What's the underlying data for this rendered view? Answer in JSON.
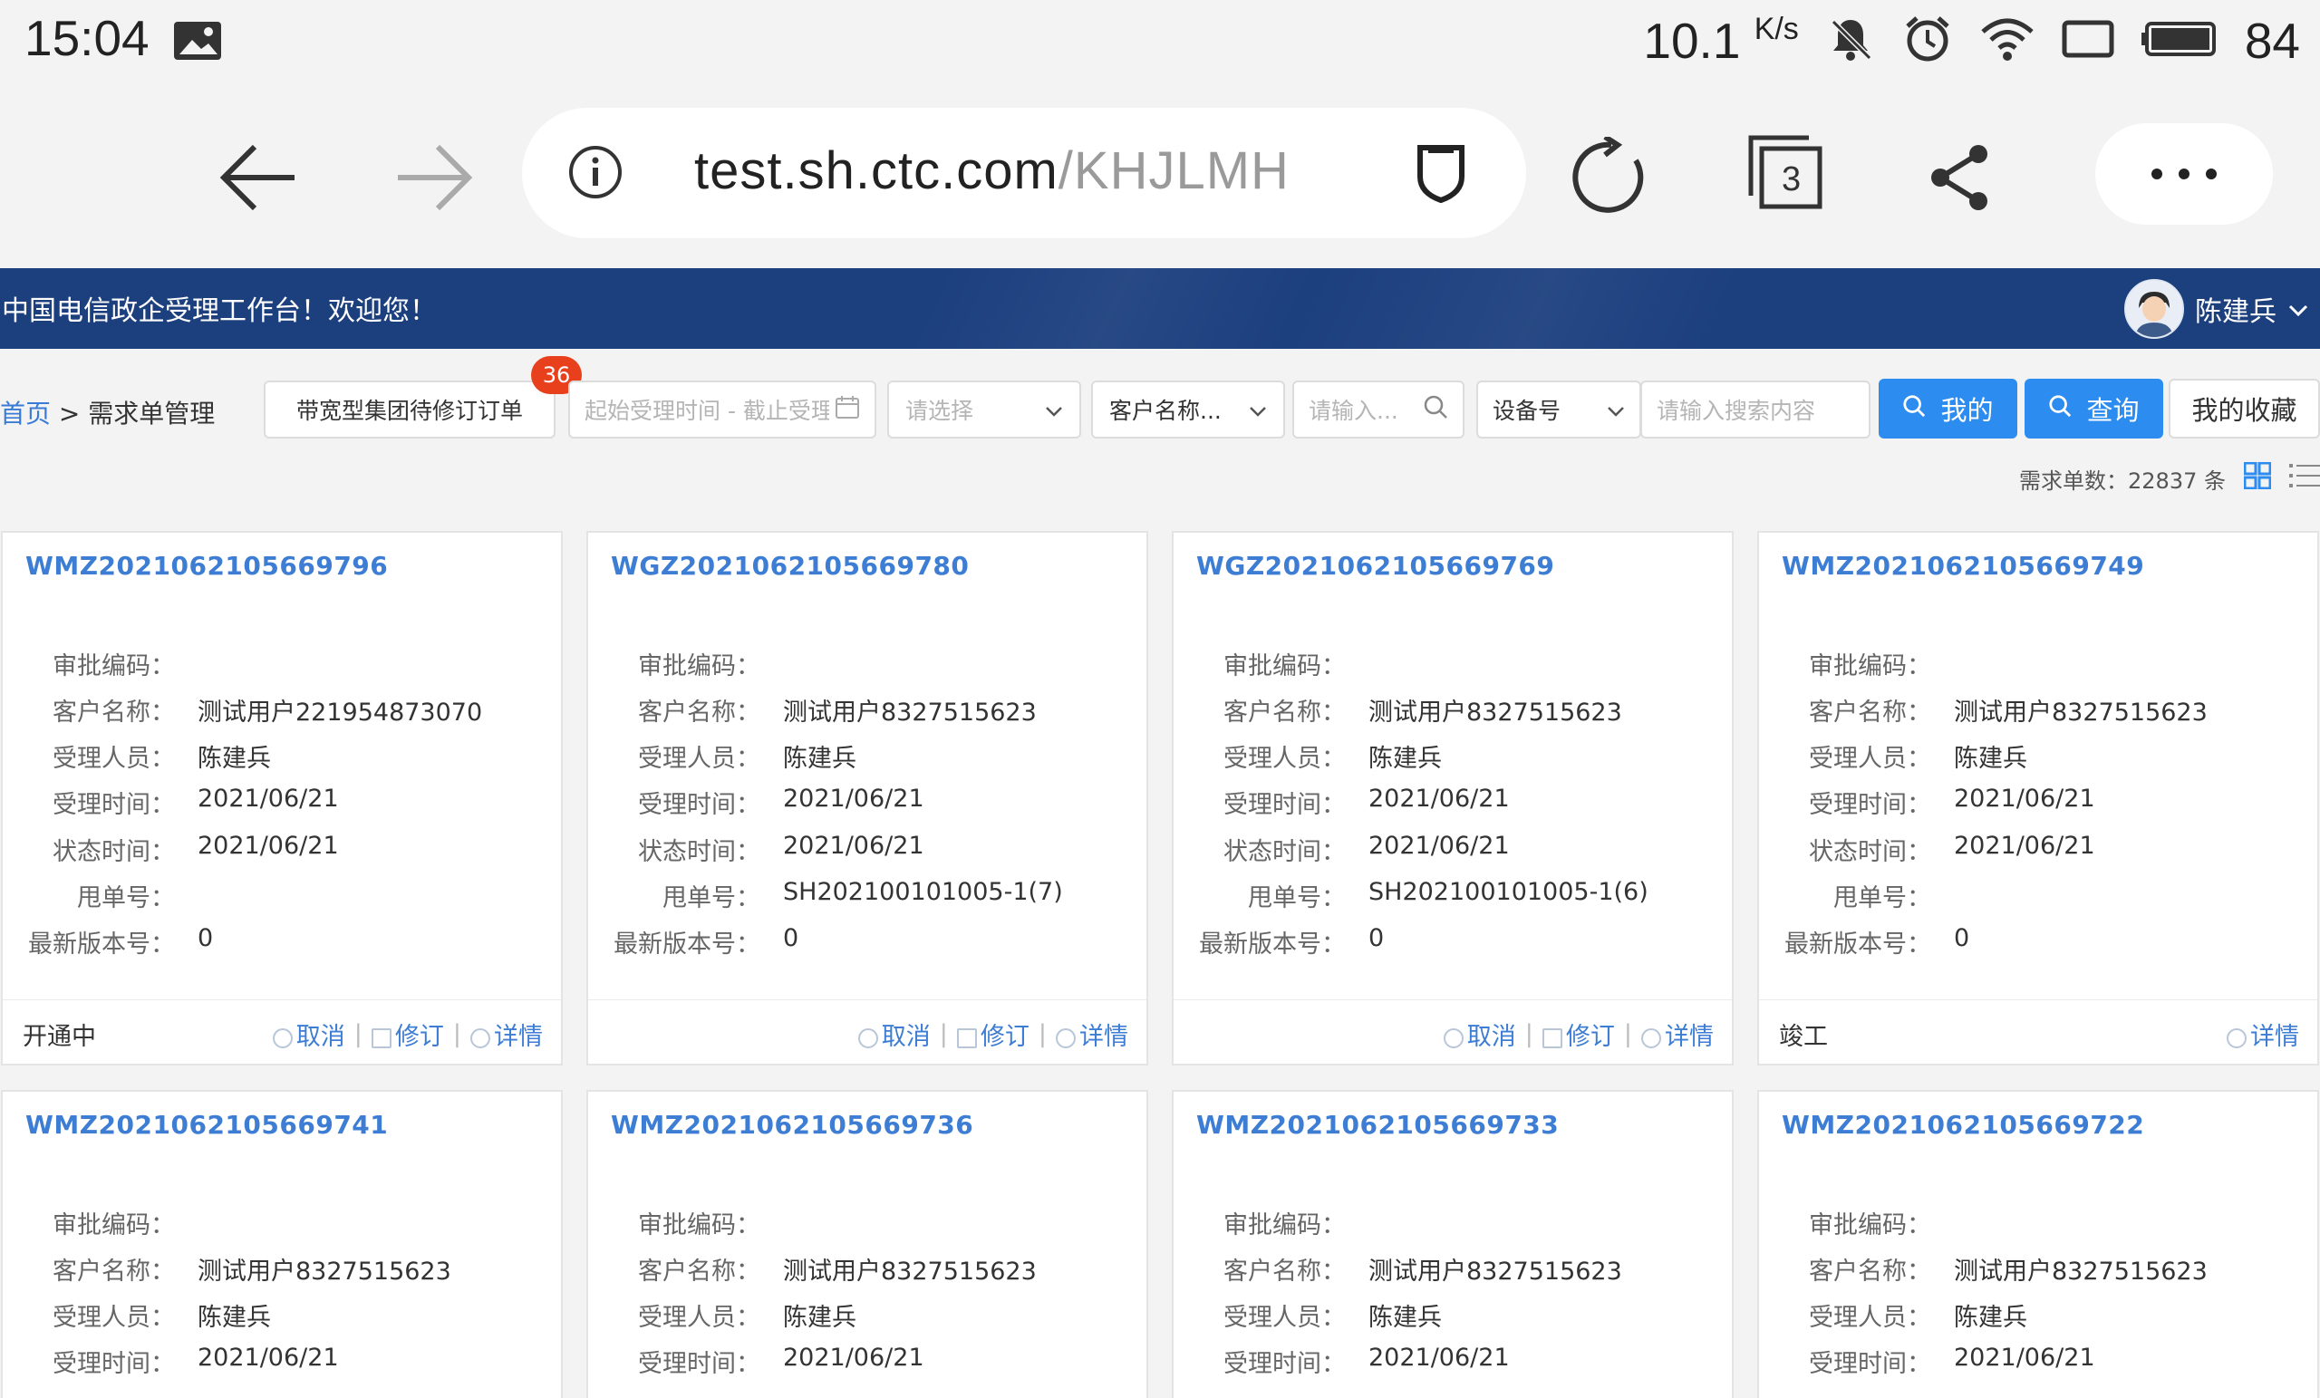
{
  "statusbar": {
    "time": "15:04",
    "speed_value": "10.1",
    "speed_unit": "K/s",
    "battery": "84"
  },
  "browser": {
    "url_host": "test.sh.ctc.com",
    "url_path": "/KHJLMH",
    "tab_count": "3"
  },
  "banner": {
    "welcome": "中国电信政企受理工作台！欢迎您！",
    "username": "陈建兵"
  },
  "breadcrumb": {
    "home": "首页",
    "sep": " > ",
    "current": "需求单管理"
  },
  "toolbar": {
    "order_type": "带宽型集团待修订订单",
    "badge": "36",
    "date_placeholder": "起始受理时间 - 截止受理",
    "select_placeholder": "请选择",
    "customer_select": "客户名称...",
    "input_placeholder": "请输入...",
    "device_select": "设备号",
    "search_placeholder": "请输入搜索内容",
    "mine_label": "我的",
    "query_label": "查询",
    "favorites_label": "我的收藏"
  },
  "summary": {
    "count_label": "需求单数：22837 条"
  },
  "labels": {
    "approval": "审批编码：",
    "customer": "客户名称：",
    "handler": "受理人员：",
    "accept_time": "受理时间：",
    "status_time": "状态时间：",
    "throw_no": "甩单号：",
    "version": "最新版本号："
  },
  "actions": {
    "cancel": "取消",
    "revise": "修订",
    "detail": "详情",
    "sep": "|"
  },
  "cards": [
    {
      "id": "WMZ2021062105669796",
      "approval": "",
      "customer": "测试用户221954873070",
      "handler": "陈建兵",
      "accept_time": "2021/06/21",
      "status_time": "2021/06/21",
      "throw_no": "",
      "version": "0",
      "status": "开通中"
    },
    {
      "id": "WGZ2021062105669780",
      "approval": "",
      "customer": "测试用户8327515623",
      "handler": "陈建兵",
      "accept_time": "2021/06/21",
      "status_time": "2021/06/21",
      "throw_no": "SH202100101005-1(7)",
      "version": "0",
      "status": ""
    },
    {
      "id": "WGZ2021062105669769",
      "approval": "",
      "customer": "测试用户8327515623",
      "handler": "陈建兵",
      "accept_time": "2021/06/21",
      "status_time": "2021/06/21",
      "throw_no": "SH202100101005-1(6)",
      "version": "0",
      "status": ""
    },
    {
      "id": "WMZ2021062105669749",
      "approval": "",
      "customer": "测试用户8327515623",
      "handler": "陈建兵",
      "accept_time": "2021/06/21",
      "status_time": "2021/06/21",
      "throw_no": "",
      "version": "0",
      "status": "竣工"
    },
    {
      "id": "WMZ2021062105669741",
      "approval": "",
      "customer": "测试用户8327515623",
      "handler": "陈建兵",
      "accept_time": "2021/06/21"
    },
    {
      "id": "WMZ2021062105669736",
      "approval": "",
      "customer": "测试用户8327515623",
      "handler": "陈建兵",
      "accept_time": "2021/06/21"
    },
    {
      "id": "WMZ2021062105669733",
      "approval": "",
      "customer": "测试用户8327515623",
      "handler": "陈建兵",
      "accept_time": "2021/06/21"
    },
    {
      "id": "WMZ2021062105669722",
      "approval": "",
      "customer": "测试用户8327515623",
      "handler": "陈建兵",
      "accept_time": "2021/06/21"
    }
  ]
}
